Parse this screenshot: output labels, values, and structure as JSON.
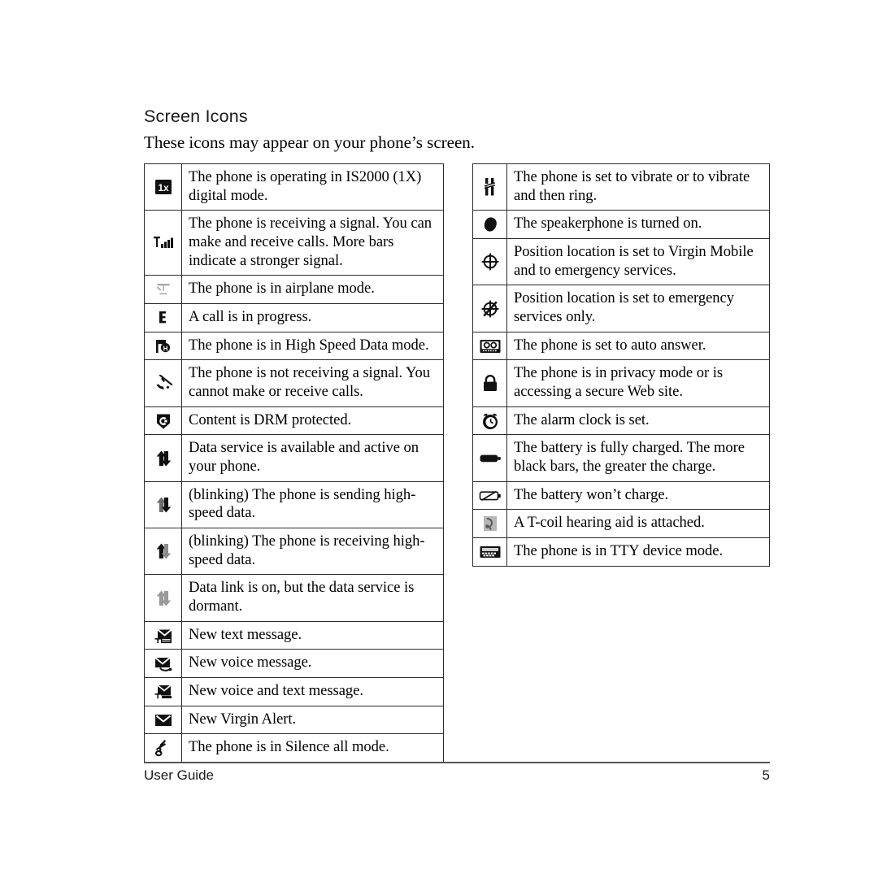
{
  "page": {
    "title": "Screen Icons",
    "subtitle": "These icons may appear on your phone’s screen."
  },
  "footer": {
    "left_label": "User Guide",
    "page_number": "5",
    "rule_color": "#555555"
  },
  "tables": {
    "left": {
      "rows": [
        {
          "icon": "1x-digital-mode-icon",
          "text": "The phone is operating in IS2000 (1X) digital mode."
        },
        {
          "icon": "signal-bars-icon",
          "text": "The phone is receiving a signal. You can make and receive calls. More bars indicate a stronger signal."
        },
        {
          "icon": "airplane-mode-icon",
          "text": "The phone is in airplane mode."
        },
        {
          "icon": "call-in-progress-icon",
          "text": "A call is in progress."
        },
        {
          "icon": "high-speed-data-icon",
          "text": "The phone is in High Speed Data mode."
        },
        {
          "icon": "no-signal-icon",
          "text": "The phone is not receiving a signal. You cannot make or receive calls."
        },
        {
          "icon": "drm-shield-icon",
          "text": "Content is DRM protected."
        },
        {
          "icon": "data-active-icon",
          "text": "Data service is available and active on your phone."
        },
        {
          "icon": "data-sending-icon",
          "text": "(blinking) The phone is sending high-speed data."
        },
        {
          "icon": "data-receiving-icon",
          "text": "(blinking) The phone is receiving high-speed data."
        },
        {
          "icon": "data-dormant-icon",
          "text": "Data link is on, but the data service is dormant."
        },
        {
          "icon": "new-text-message-icon",
          "text": "New text message."
        },
        {
          "icon": "new-voice-message-icon",
          "text": "New voice message."
        },
        {
          "icon": "new-voice-and-text-icon",
          "text": "New voice and text message."
        },
        {
          "icon": "new-virgin-alert-icon",
          "text": "New Virgin Alert."
        },
        {
          "icon": "silence-all-icon",
          "text": "The phone is in Silence all mode."
        }
      ]
    },
    "right": {
      "rows": [
        {
          "icon": "vibrate-icon",
          "text": "The phone is set to vibrate or to vibrate and then ring."
        },
        {
          "icon": "speakerphone-icon",
          "text": "The speakerphone is turned on."
        },
        {
          "icon": "position-location-on-icon",
          "text": "Position location is set to Virgin Mobile and to emergency services."
        },
        {
          "icon": "position-location-911-icon",
          "text": "Position location is set to emergency services only."
        },
        {
          "icon": "auto-answer-icon",
          "text": "The phone is set to auto answer."
        },
        {
          "icon": "privacy-lock-icon",
          "text": "The phone is in privacy mode or is accessing a secure Web site."
        },
        {
          "icon": "alarm-clock-icon",
          "text": "The alarm clock is set."
        },
        {
          "icon": "battery-full-icon",
          "text": "The battery is fully charged. The more black bars, the greater the charge."
        },
        {
          "icon": "battery-no-charge-icon",
          "text": "The battery won’t charge."
        },
        {
          "icon": "tcoil-hearing-aid-icon",
          "text": "A T-coil hearing aid is attached."
        },
        {
          "icon": "tty-device-icon",
          "text": "The phone is in TTY device mode."
        }
      ]
    }
  }
}
